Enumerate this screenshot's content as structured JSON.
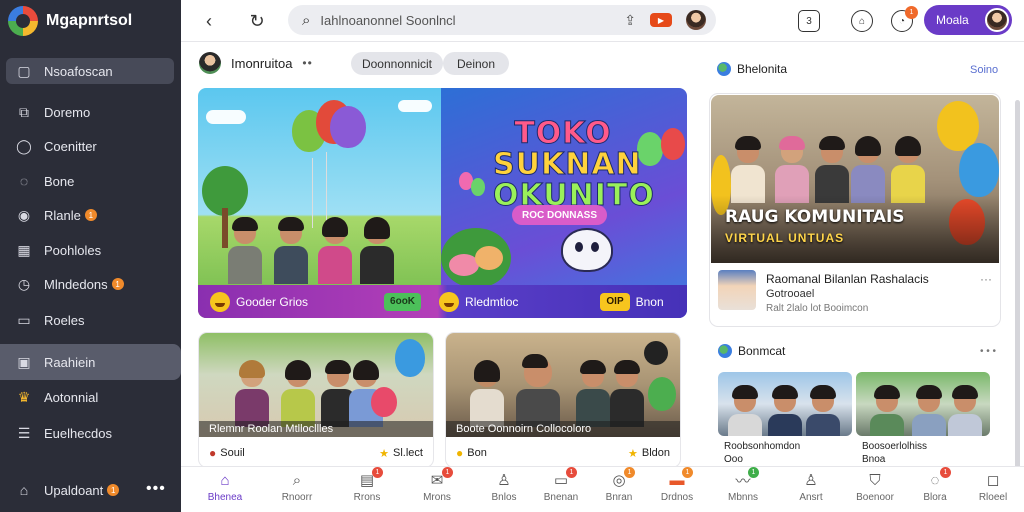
{
  "app": {
    "name": "Mgapnrtsol"
  },
  "sidebar": {
    "items": [
      {
        "label": "Nsoafoscan",
        "icon": "square-icon"
      },
      {
        "label": "Doremo",
        "icon": "frame-icon"
      },
      {
        "label": "Coenitter",
        "icon": "chat-icon"
      },
      {
        "label": "Bone",
        "icon": "bubble-icon"
      },
      {
        "label": "Rlanle",
        "icon": "camera-icon",
        "badge": "1"
      },
      {
        "label": "Poohloles",
        "icon": "grid-icon"
      },
      {
        "label": "Mlndedons",
        "icon": "clock-icon",
        "badge": "1"
      },
      {
        "label": "Roeles",
        "icon": "folder-icon"
      },
      {
        "label": "Raahiein",
        "icon": "image-icon"
      },
      {
        "label": "Aotonnial",
        "icon": "crown-icon"
      },
      {
        "label": "Euelhecdos",
        "icon": "list-icon"
      },
      {
        "label": "Upaldoant",
        "icon": "home-icon",
        "badge": "1"
      }
    ],
    "more": "•••"
  },
  "topbar": {
    "search_text": "Iahlnoanonnel Soonlncl",
    "user_label": "Moala",
    "notif_count": "1",
    "page_ico_text": "3"
  },
  "feed": {
    "header_name": "Imonruitoa",
    "header_dots": "••",
    "chips": [
      "Doonnonnicit",
      "Deinon"
    ]
  },
  "hero": {
    "title_lines": [
      "TOKO",
      "SUKNAN",
      "OKUNITO"
    ],
    "subtitle": "ROC DONNASS",
    "bar_left_text": "Gooder Grios",
    "bar_left_tag": "6ooK",
    "bar_mid_text": "Rledmtioc",
    "bar_right_tag": "OIP",
    "bar_right_text": "Bnon"
  },
  "cards": [
    {
      "caption": "Rlemnr Roolan Mtllocllles",
      "foot_left": "Souil",
      "foot_right": "Sl.lect"
    },
    {
      "caption": "Boote Oonnoirn Collocoloro",
      "foot_left": "Bon",
      "foot_right": "Bldon"
    }
  ],
  "right_panel": {
    "header": "Bhelonita",
    "link": "Soino",
    "feature_title": "RAUG KOMUNITAIS",
    "feature_sub": "VIRTUAL UNTUAS",
    "line1": "Raomanal Bilanlan Rashalacis",
    "line2": "Gotrooael",
    "line3": "Ralt 2lalo lot Booimcon",
    "section2": "Bonmcat",
    "section2_dots": "• • •",
    "videos": [
      {
        "line1": "Roobsonhomdon",
        "line2": "Ooo"
      },
      {
        "line1": "Boosoerlolhiss",
        "line2": "Bnoa"
      }
    ]
  },
  "bottom_nav": [
    {
      "label": "Bhenea",
      "icon": "home-icon",
      "active": true
    },
    {
      "label": "Rnoorr",
      "icon": "search-icon"
    },
    {
      "label": "Rrons",
      "icon": "inbox-icon",
      "badge": "1"
    },
    {
      "label": "Mrons",
      "icon": "mail-icon",
      "badge": "1"
    },
    {
      "label": "Bnlos",
      "icon": "user-icon"
    },
    {
      "label": "Bnenan",
      "icon": "bag-icon",
      "badge": "1"
    },
    {
      "label": "Bnran",
      "icon": "target-icon",
      "badge": "1"
    },
    {
      "label": "Drdnos",
      "icon": "shop-icon",
      "badge": "1"
    },
    {
      "label": "Mbnns",
      "icon": "wave-icon",
      "badge": "1"
    },
    {
      "label": "Ansrt",
      "icon": "person-icon"
    },
    {
      "label": "Boenoor",
      "icon": "shield-icon"
    },
    {
      "label": "Blora",
      "icon": "bell-icon",
      "badge": "1"
    },
    {
      "label": "Rloeel",
      "icon": "chat-icon"
    }
  ],
  "colors": {
    "accent": "#6a3bc7",
    "sidebar_bg": "#2b2d38",
    "badge": "#f08a2b"
  }
}
